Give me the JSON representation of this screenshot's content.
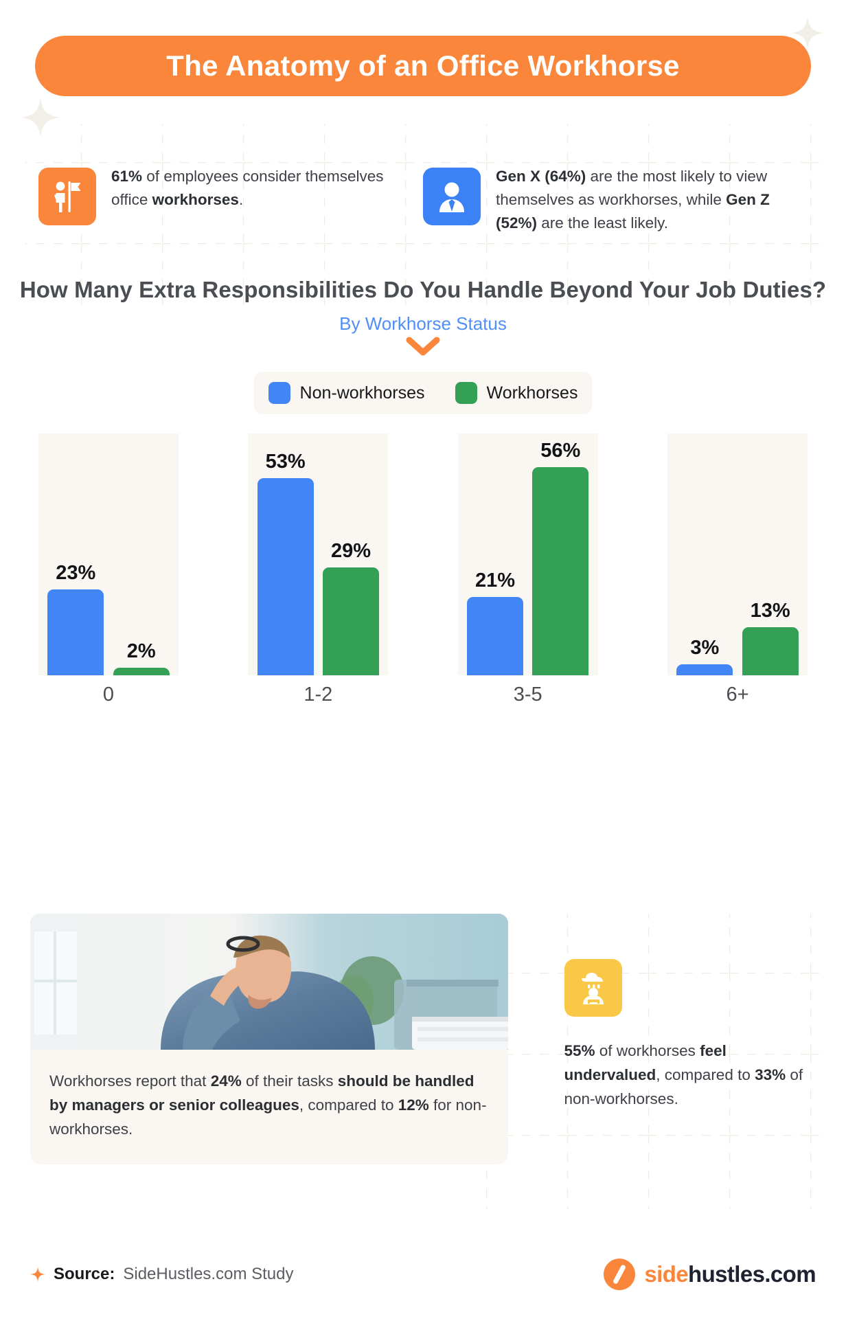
{
  "header": {
    "title": "The Anatomy of an Office Workhorse",
    "pill_color": "#f9863a"
  },
  "stats": [
    {
      "icon": "person-with-flag-icon",
      "icon_color": "#f9863a",
      "parts": [
        {
          "text": "61%",
          "bold": true
        },
        {
          "text": " of employees consider themselves office ",
          "bold": false
        },
        {
          "text": "workhorses",
          "bold": true
        },
        {
          "text": ".",
          "bold": false
        }
      ]
    },
    {
      "icon": "business-person-avatar-icon",
      "icon_color": "#3b82f6",
      "parts": [
        {
          "text": "Gen X (64%)",
          "bold": true
        },
        {
          "text": " are the most likely to view themselves as workhorses, while ",
          "bold": false
        },
        {
          "text": "Gen Z (52%)",
          "bold": true
        },
        {
          "text": " are the least likely.",
          "bold": false
        }
      ]
    }
  ],
  "chart_data": {
    "type": "bar",
    "title": "How Many Extra Responsibilities Do You Handle Beyond Your Job Duties?",
    "subtitle": "By Workhorse Status",
    "xlabel": "",
    "ylabel": "",
    "ylim": [
      0,
      65
    ],
    "grid": false,
    "legend_position": "top-center",
    "categories": [
      "0",
      "1-2",
      "3-5",
      "6+"
    ],
    "series": [
      {
        "name": "Non-workhorses",
        "color": "#4285f4",
        "values": [
          23,
          53,
          21,
          3
        ],
        "labels": [
          "23%",
          "53%",
          "21%",
          "3%"
        ]
      },
      {
        "name": "Workhorses",
        "color": "#34a056",
        "values": [
          2,
          29,
          56,
          13
        ],
        "labels": [
          "2%",
          "29%",
          "56%",
          "13%"
        ]
      }
    ]
  },
  "bottom": {
    "photo_alt": "stressed-office-worker-photo",
    "caption_parts": [
      {
        "text": "Workhorses report that ",
        "bold": false
      },
      {
        "text": "24%",
        "bold": true
      },
      {
        "text": " of their tasks ",
        "bold": false
      },
      {
        "text": "should be handled by managers or senior colleagues",
        "bold": true
      },
      {
        "text": ", compared to ",
        "bold": false
      },
      {
        "text": "12%",
        "bold": true
      },
      {
        "text": " for non-workhorses.",
        "bold": false
      }
    ],
    "side_icon": "sad-person-rain-cloud-icon",
    "side_icon_color": "#f9c846",
    "side_parts": [
      {
        "text": "55%",
        "bold": true
      },
      {
        "text": " of workhorses ",
        "bold": false
      },
      {
        "text": "feel undervalued",
        "bold": true
      },
      {
        "text": ", compared to ",
        "bold": false
      },
      {
        "text": "33%",
        "bold": true
      },
      {
        "text": " of non-workhorses.",
        "bold": false
      }
    ]
  },
  "footer": {
    "source_label": "Source:",
    "source_value": "SideHustles.com Study",
    "logo_a": "side",
    "logo_b": "hustles.com"
  }
}
